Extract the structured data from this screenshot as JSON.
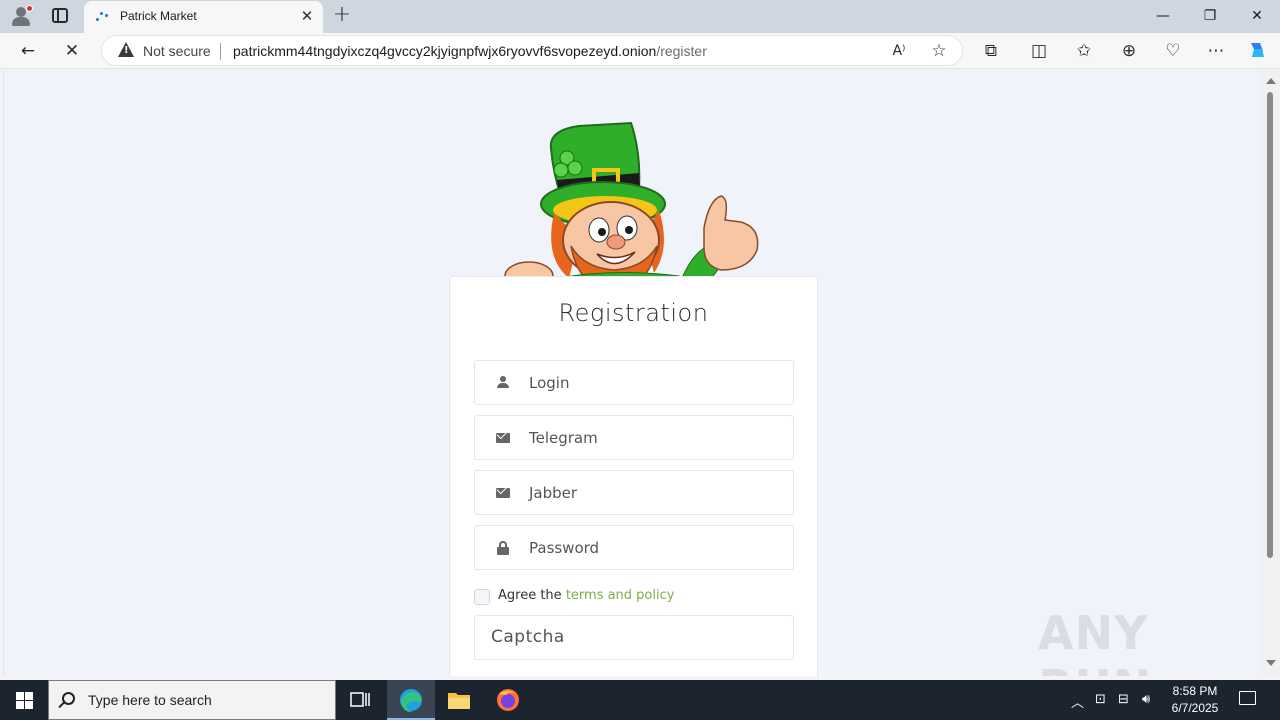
{
  "browser": {
    "tab": {
      "title": "Patrick Market"
    },
    "address": {
      "security_label": "Not secure",
      "url_host": "patrickmm44tngdyixczq4gvccy2kjyignpfwjx6ryovvf6svopezeyd.onion",
      "url_path": "/register"
    }
  },
  "page": {
    "title": "Registration",
    "fields": {
      "login_placeholder": "Login",
      "telegram_placeholder": "Telegram",
      "jabber_placeholder": "Jabber",
      "password_placeholder": "Password",
      "captcha_placeholder": "Captcha"
    },
    "agree": {
      "prefix": "Agree the ",
      "link": "terms and policy"
    },
    "colors": {
      "link": "#7bb045",
      "mascot_hat": "#2fae2a"
    }
  },
  "watermark": "ANY RUN",
  "taskbar": {
    "search_placeholder": "Type here to search",
    "time": "8:58 PM",
    "date": "6/7/2025"
  }
}
